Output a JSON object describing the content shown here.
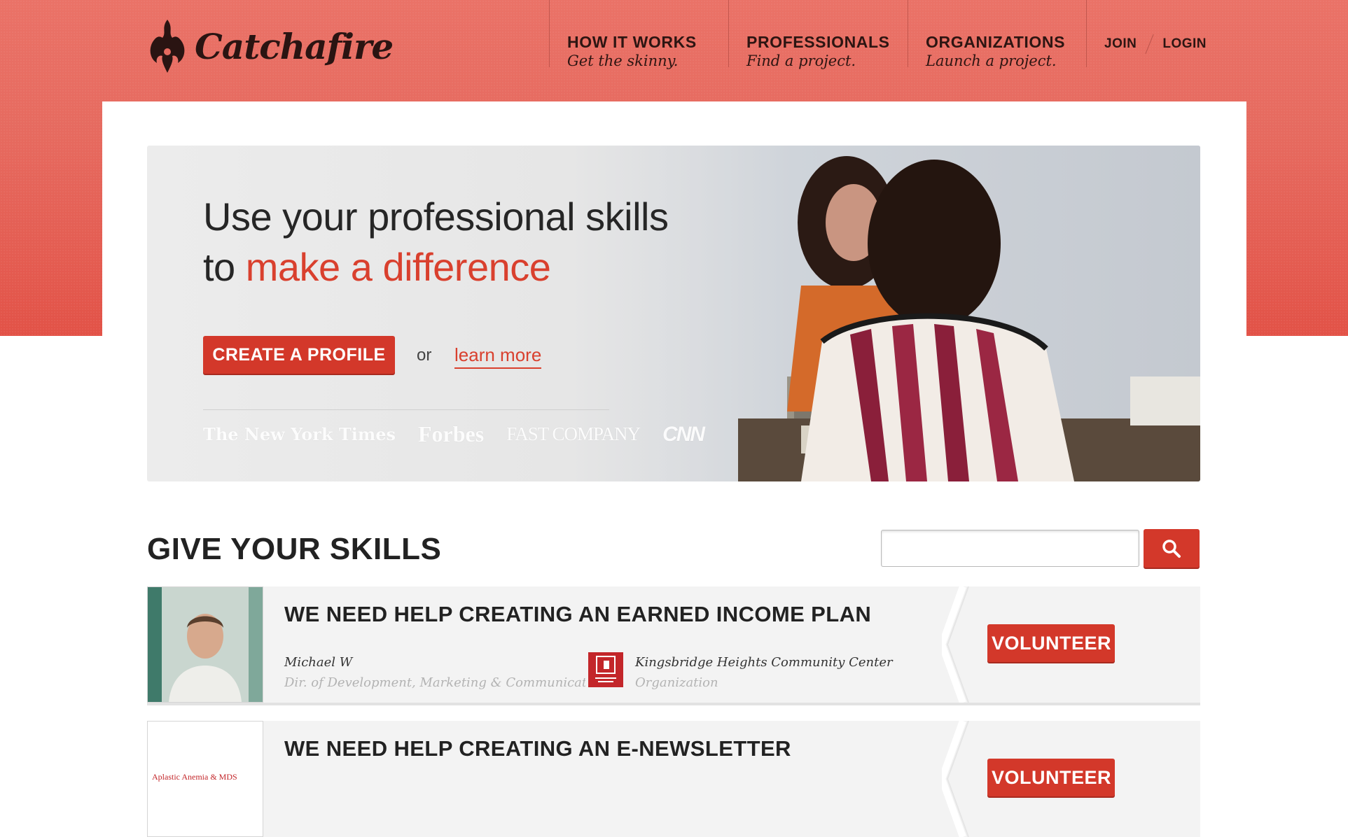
{
  "header": {
    "logo_text": "Catchafire",
    "nav": [
      {
        "title": "HOW IT WORKS",
        "subtitle": "Get the skinny."
      },
      {
        "title": "PROFESSIONALS",
        "subtitle": "Find a project."
      },
      {
        "title": "ORGANIZATIONS",
        "subtitle": "Launch a project."
      }
    ],
    "join": "JOIN",
    "login": "LOGIN"
  },
  "hero": {
    "line1": "Use your professional skills",
    "line2_prefix": "to ",
    "line2_highlight": "make a difference",
    "cta": "CREATE A PROFILE",
    "or": "or",
    "learn_more": "learn more",
    "press": [
      "The New York Times",
      "Forbes",
      "FAST COMPANY",
      "CNN"
    ]
  },
  "skills": {
    "title": "GIVE YOUR SKILLS",
    "search_placeholder": "",
    "projects": [
      {
        "title": "WE NEED HELP CREATING AN EARNED INCOME PLAN",
        "person_name": "Michael W",
        "person_role": "Dir. of Development, Marketing & Communication",
        "org_name": "Kingsbridge Heights Community Center",
        "org_type": "Organization",
        "button": "VOLUNTEER"
      },
      {
        "title": "WE NEED HELP CREATING AN E-NEWSLETTER",
        "thumb_text": "Aplastic Anemia & MDS",
        "button": "VOLUNTEER"
      }
    ]
  },
  "colors": {
    "brand_red": "#d3382a",
    "header_coral": "#e66a5f",
    "text_dark": "#222222"
  },
  "icons": [
    "flame-logo-icon",
    "search-icon",
    "chevron-divider-icon"
  ]
}
